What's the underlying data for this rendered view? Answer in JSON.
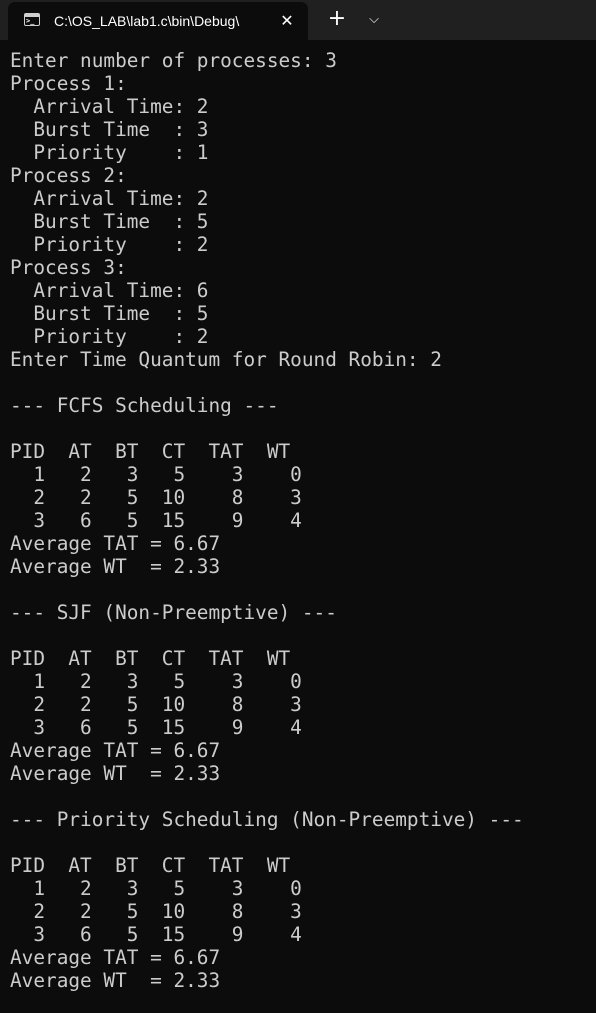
{
  "tab": {
    "title": "C:\\OS_LAB\\lab1.c\\bin\\Debug\\",
    "icon": "terminal-icon",
    "close_glyph": "✕",
    "new_tab_glyph": "+",
    "dropdown_glyph": "⌵"
  },
  "colors": {
    "titlebar_bg": "#202020",
    "console_bg": "#0c0c0c",
    "console_text": "#cccccc"
  },
  "console": {
    "lines": [
      "Enter number of processes: 3",
      "Process 1:",
      "  Arrival Time: 2",
      "  Burst Time  : 3",
      "  Priority    : 1",
      "Process 2:",
      "  Arrival Time: 2",
      "  Burst Time  : 5",
      "  Priority    : 2",
      "Process 3:",
      "  Arrival Time: 6",
      "  Burst Time  : 5",
      "  Priority    : 2",
      "Enter Time Quantum for Round Robin: 2",
      "",
      "--- FCFS Scheduling ---",
      "",
      "PID  AT  BT  CT  TAT  WT",
      "  1   2   3   5    3    0",
      "  2   2   5  10    8    3",
      "  3   6   5  15    9    4",
      "Average TAT = 6.67",
      "Average WT  = 2.33",
      "",
      "--- SJF (Non-Preemptive) ---",
      "",
      "PID  AT  BT  CT  TAT  WT",
      "  1   2   3   5    3    0",
      "  2   2   5  10    8    3",
      "  3   6   5  15    9    4",
      "Average TAT = 6.67",
      "Average WT  = 2.33",
      "",
      "--- Priority Scheduling (Non-Preemptive) ---",
      "",
      "PID  AT  BT  CT  TAT  WT",
      "  1   2   3   5    3    0",
      "  2   2   5  10    8    3",
      "  3   6   5  15    9    4",
      "Average TAT = 6.67",
      "Average WT  = 2.33"
    ]
  }
}
